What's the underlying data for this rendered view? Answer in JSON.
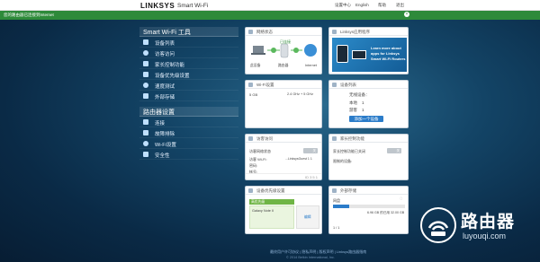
{
  "header": {
    "logo": "LINKSYS",
    "product": "Smart Wi-Fi",
    "links": [
      "设置中心",
      "English",
      "帮助",
      "退出"
    ]
  },
  "banner": {
    "text": "您的路由器已连接到Internet"
  },
  "sidebar": {
    "tools_title": "Smart Wi-Fi 工具",
    "tools": [
      {
        "label": "设备列表",
        "icon": "device-list-icon"
      },
      {
        "label": "访客访问",
        "icon": "guest-icon"
      },
      {
        "label": "家长控制功能",
        "icon": "parental-icon"
      },
      {
        "label": "设备优先级设置",
        "icon": "priority-icon"
      },
      {
        "label": "速度测试",
        "icon": "speedtest-icon"
      },
      {
        "label": "外部存储",
        "icon": "storage-icon"
      }
    ],
    "router_title": "路由器设置",
    "router": [
      {
        "label": "连接",
        "icon": "connect-icon"
      },
      {
        "label": "故障排除",
        "icon": "troubleshoot-icon"
      },
      {
        "label": "Wi-Fi设置",
        "icon": "wifi-icon"
      },
      {
        "label": "安全性",
        "icon": "shield-icon"
      }
    ]
  },
  "cards": {
    "network": {
      "title": "网络状态",
      "status": "已连接",
      "labels": [
        "此设备",
        "路由器",
        "Internet"
      ]
    },
    "linksys_app": {
      "title": "Linksys应用程序",
      "lines": [
        "Learn more about",
        "apps for Linksys",
        "Smart Wi-Fi Routers"
      ]
    },
    "wifi": {
      "title": "Wi-Fi设置",
      "band": "5 GB",
      "value": "2.4 GHz + 5 GHz"
    },
    "devices": {
      "title": "设备列表",
      "subtitle": "无线设备：",
      "rows": [
        {
          "k": "本地",
          "v": "1"
        },
        {
          "k": "游客",
          "v": "1"
        }
      ],
      "button": "添加一个设备"
    },
    "guest": {
      "title": "访客访问",
      "row1": "访客网络状态",
      "guest_wifi_label": "访客 Wi-Fi:",
      "guest_wifi_value": "...LinksysGuest 1 1",
      "pass_label": "密码:",
      "hint": "帐号:",
      "toggle": "关",
      "foot": "ID  3 5 1"
    },
    "parental": {
      "title": "家长控制功能",
      "row1": "家长控制功能已关闭",
      "row2": "限制的设备:",
      "toggle": "关"
    },
    "priority": {
      "title": "设备优先级设置",
      "col1": "高优先级",
      "device": "Galaxy Note II",
      "edit": "编辑"
    },
    "storage": {
      "title": "外部存储",
      "name": "网盘",
      "size": "6.96 GB 的已用 32.00 GB",
      "page": "1 / 1"
    }
  },
  "footer": {
    "line1": "最终用户许可协议  |  隐私声明  |  版权声明  |  Linksys路由器指南",
    "line2": "© 2014 Belkin International, Inc."
  },
  "watermark": {
    "title": "路由器",
    "sub": "luyouqi.com"
  }
}
